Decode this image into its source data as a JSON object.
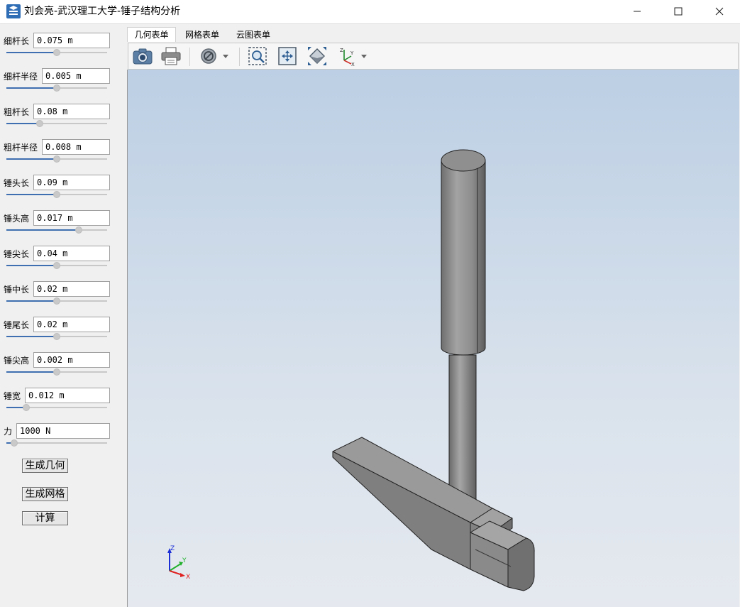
{
  "window": {
    "title": "刘会亮-武汉理工大学-锤子结构分析",
    "controls": [
      "minimize-icon",
      "maximize-icon",
      "close-icon"
    ]
  },
  "params": [
    {
      "label": "细杆长",
      "value": "0.075 m",
      "slider": 0.5
    },
    {
      "label": "细杆半径",
      "value": "0.005 m",
      "slider": 0.5
    },
    {
      "label": "粗杆长",
      "value": "0.08 m",
      "slider": 0.33
    },
    {
      "label": "粗杆半径",
      "value": "0.008 m",
      "slider": 0.5
    },
    {
      "label": "锤头长",
      "value": "0.09 m",
      "slider": 0.5
    },
    {
      "label": "锤头高",
      "value": "0.017 m",
      "slider": 0.72
    },
    {
      "label": "锤尖长",
      "value": "0.04 m",
      "slider": 0.5
    },
    {
      "label": "锤中长",
      "value": "0.02 m",
      "slider": 0.5
    },
    {
      "label": "锤尾长",
      "value": "0.02 m",
      "slider": 0.5
    },
    {
      "label": "锤尖高",
      "value": "0.002 m",
      "slider": 0.5
    },
    {
      "label": "锤宽",
      "value": "0.012 m",
      "slider": 0.2
    },
    {
      "label": "力",
      "value": "1000 N",
      "slider": 0.08
    }
  ],
  "buttons": {
    "generate_geometry": "生成几何",
    "generate_mesh": "生成网格",
    "compute": "计算"
  },
  "tabs": [
    "几何表单",
    "网格表单",
    "云图表单"
  ],
  "active_tab": 0,
  "toolbar_icons": [
    "camera-icon",
    "print-icon",
    "visibility-icon",
    "zoom-box-icon",
    "fit-all-icon",
    "view-iso-icon",
    "axes-view-icon"
  ],
  "axis_labels": {
    "z": "Z",
    "y": "Y",
    "x": "X"
  },
  "colors": {
    "accent": "#3f6fb0",
    "model_gray": "#8a8a8a"
  }
}
